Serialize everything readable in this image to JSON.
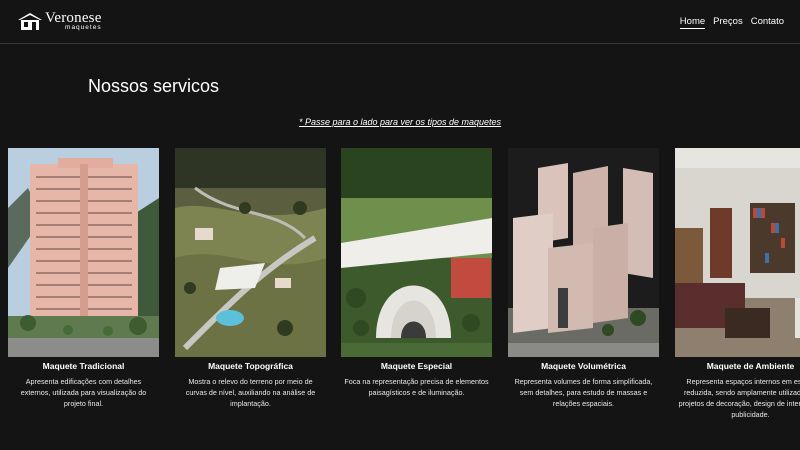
{
  "header": {
    "logo": {
      "name": "Veronese",
      "sub": "maquetes"
    },
    "nav": [
      {
        "label": "Home",
        "active": true
      },
      {
        "label": "Preços",
        "active": false
      },
      {
        "label": "Contato",
        "active": false
      }
    ]
  },
  "section": {
    "title": "Nossos servicos",
    "hint": "* Passe para o lado para ver os tipos de maquetes"
  },
  "cards": [
    {
      "title": "Maquete Tradicional",
      "description": "Apresenta edificações com detalhes externos, utilizada para visualização do projeto final."
    },
    {
      "title": "Maquete Topográfica",
      "description": "Mostra o relevo do terreno por meio de curvas de nível, auxiliando na análise de implantação."
    },
    {
      "title": "Maquete Especial",
      "description": "Foca na representação precisa de elementos paisagísticos e de iluminação."
    },
    {
      "title": "Maquete Volumétrica",
      "description": "Representa volumes de forma simplificada, sem detalhes, para estudo de massas e relações espaciais."
    },
    {
      "title": "Maquete de Ambiente",
      "description": "Representa espaços internos em escala reduzida, sendo amplamente utilizada em projetos de decoração, design de interiores e publicidade."
    }
  ],
  "colors": {
    "background": "#141414",
    "text": "#ffffff",
    "divider": "#3a3a3a"
  }
}
